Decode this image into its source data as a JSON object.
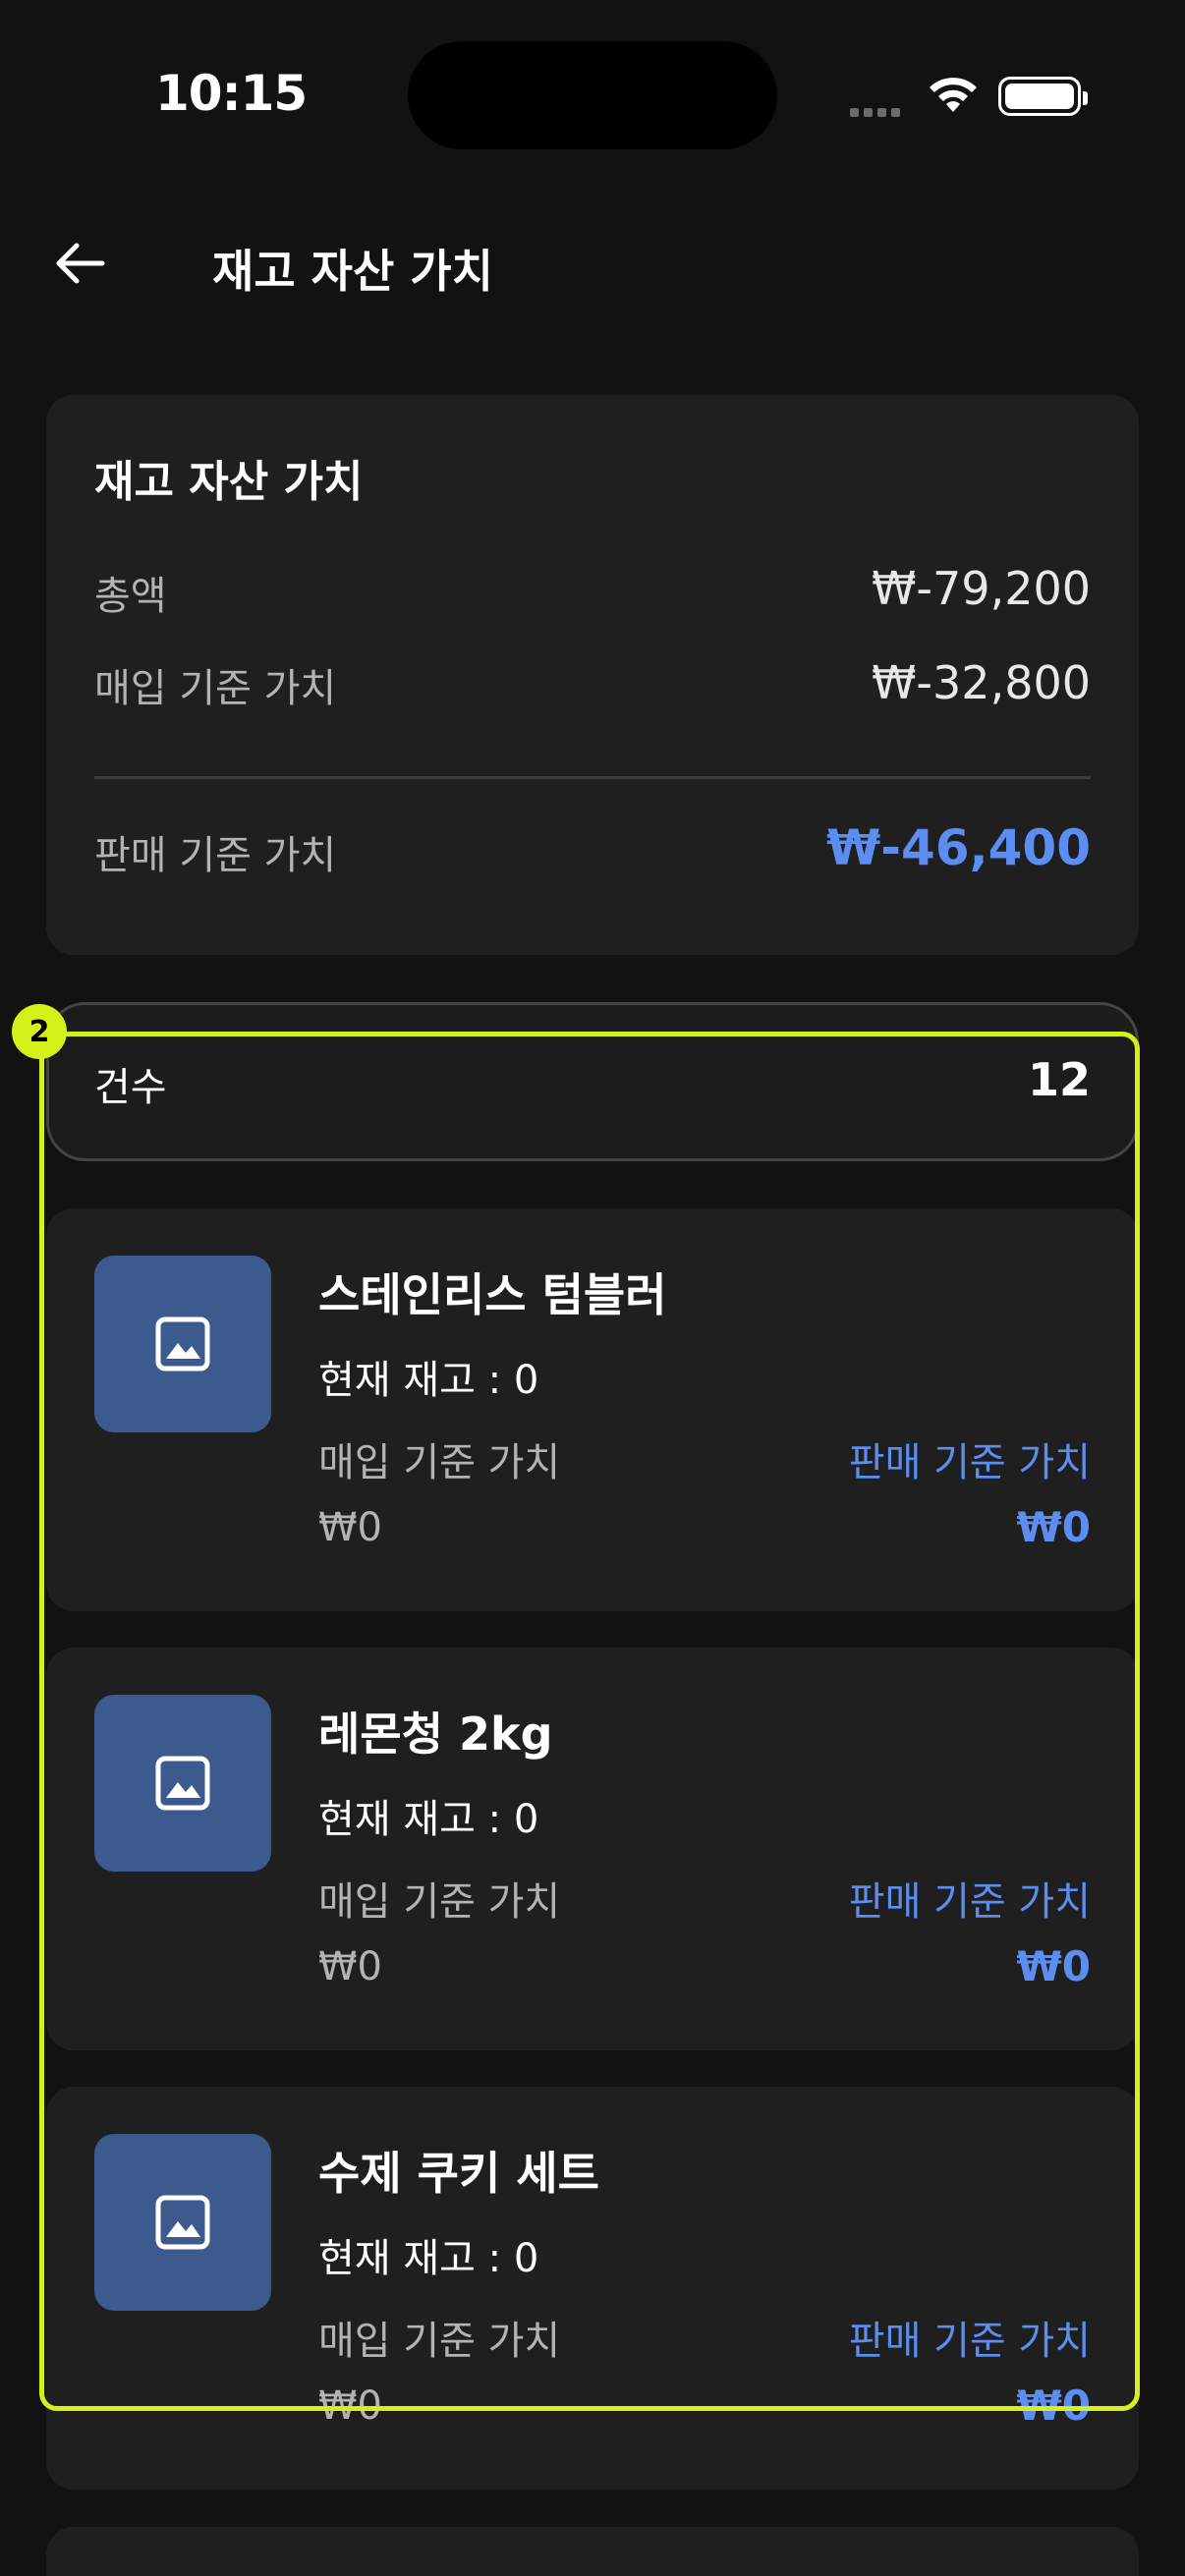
{
  "status_bar": {
    "time": "10:15"
  },
  "header": {
    "title": "재고 자산 가치"
  },
  "summary": {
    "title": "재고 자산 가치",
    "total_label": "총액",
    "total_value": "₩-79,200",
    "purchase_label": "매입 기준 가치",
    "purchase_value": "₩-32,800",
    "sale_label": "판매 기준 가치",
    "sale_value": "₩-46,400"
  },
  "count": {
    "label": "건수",
    "value": "12"
  },
  "products": [
    {
      "name": "스테인리스 텀블러",
      "stock": "현재 재고 : 0",
      "buy_label": "매입 기준 가치",
      "sale_label": "판매 기준 가치",
      "buy_value": "₩0",
      "sale_value": "₩0"
    },
    {
      "name": "레몬청 2kg",
      "stock": "현재 재고 : 0",
      "buy_label": "매입 기준 가치",
      "sale_label": "판매 기준 가치",
      "buy_value": "₩0",
      "sale_value": "₩0"
    },
    {
      "name": "수제 쿠키 세트",
      "stock": "현재 재고 : 0",
      "buy_label": "매입 기준 가치",
      "sale_label": "판매 기준 가치",
      "buy_value": "₩0",
      "sale_value": "₩0"
    }
  ],
  "highlight": {
    "badge": "2",
    "color": "#d4f21a"
  },
  "colors": {
    "accent": "#5b8ef0",
    "background": "#121212",
    "card": "#1f1f1f",
    "thumb": "#3d5a8e"
  },
  "icons": {
    "back": "arrow-left-icon",
    "thumb": "image-placeholder-icon",
    "wifi": "wifi-icon",
    "battery": "battery-icon"
  }
}
